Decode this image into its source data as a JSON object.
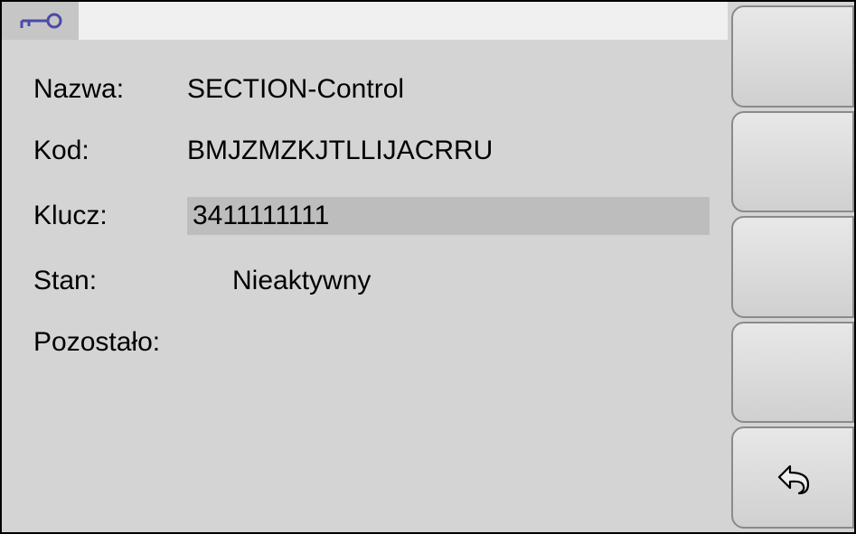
{
  "tab": {
    "icon": "key-icon"
  },
  "fields": {
    "name_label": "Nazwa:",
    "name_value": "SECTION-Control",
    "code_label": "Kod:",
    "code_value": "BMJZMZKJTLLIJACRRU",
    "key_label": "Klucz:",
    "key_value": "3411111111",
    "status_label": "Stan:",
    "status_value": "Nieaktywny",
    "remain_label": "Pozostało:",
    "remain_value": ""
  },
  "buttons": {
    "back_icon": "back-arrow-icon"
  }
}
